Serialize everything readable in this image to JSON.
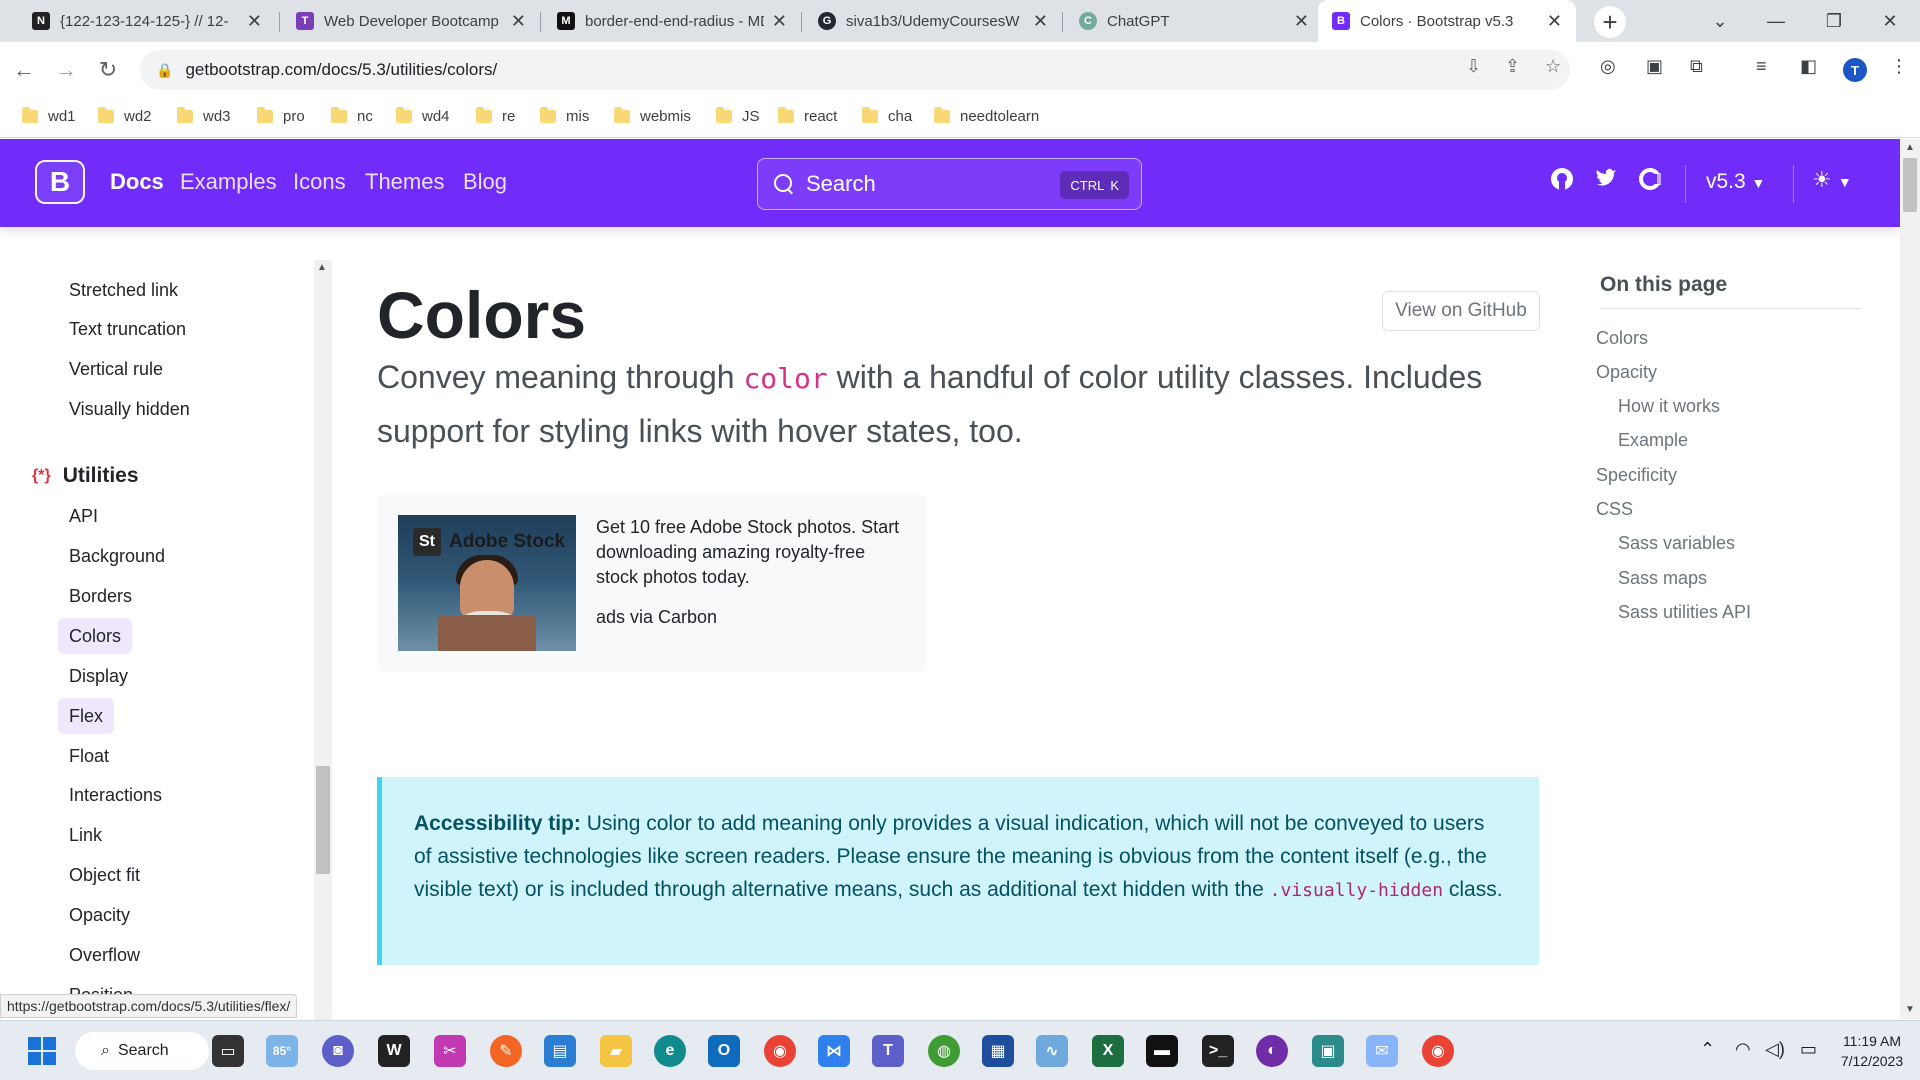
{
  "browser": {
    "tabs": [
      {
        "title": "{122-123-124-125-} // 12-",
        "favicon": "N",
        "color": "#222222"
      },
      {
        "title": "Web Developer Bootcamp",
        "favicon": "T",
        "color": "#7a3fb5"
      },
      {
        "title": "border-end-end-radius - MDN",
        "favicon": "M",
        "color": "#111111"
      },
      {
        "title": "siva1b3/UdemyCoursesW",
        "favicon": "G",
        "color": "#24292f"
      },
      {
        "title": "ChatGPT",
        "favicon": "C",
        "color": "#74aa9c"
      },
      {
        "title": "Colors · Bootstrap v5.3",
        "favicon": "B",
        "color": "#712cf9"
      }
    ],
    "url": "getbootstrap.com/docs/5.3/utilities/colors/",
    "profile_initial": "T",
    "bookmarks": [
      "wd1",
      "wd2",
      "wd3",
      "pro",
      "nc",
      "wd4",
      "re",
      "mis",
      "webmis",
      "JS",
      "react",
      "cha",
      "needtolearn"
    ]
  },
  "navbar": {
    "logo": "B",
    "links": [
      "Docs",
      "Examples",
      "Icons",
      "Themes",
      "Blog"
    ],
    "search_placeholder": "Search",
    "search_kbd_1": "CTRL",
    "search_kbd_2": "K",
    "version": "v5.3",
    "accent": "#712cf9"
  },
  "sidebar": {
    "items_top": [
      "Stretched link",
      "Text truncation",
      "Vertical rule",
      "Visually hidden"
    ],
    "section_title": "Utilities",
    "section_icon": "{*}",
    "items": [
      "API",
      "Background",
      "Borders",
      "Colors",
      "Display",
      "Flex",
      "Float",
      "Interactions",
      "Link",
      "Object fit",
      "Opacity",
      "Overflow",
      "Position"
    ]
  },
  "main": {
    "title": "Colors",
    "github_button": "View on GitHub",
    "lead_before": "Convey meaning through ",
    "lead_code": "color",
    "lead_after": " with a handful of color utility classes. Includes support for styling links with hover states, too.",
    "ad": {
      "brand_logo": "St",
      "brand_name": "Adobe Stock",
      "text": "Get 10 free Adobe Stock photos. Start downloading amazing royalty-free stock photos today.",
      "via": "ads via Carbon"
    },
    "callout": {
      "label": "Accessibility tip:",
      "text_1": " Using color to add meaning only provides a visual indication, which will not be conveyed to users of assistive technologies like screen readers. Please ensure the meaning is obvious from the content itself (e.g., the visible text) or is included through alternative means, such as additional text hidden with the ",
      "code": ".visually-hidden",
      "text_2": " class."
    }
  },
  "toc": {
    "title": "On this page",
    "items": [
      {
        "label": "Colors",
        "level": 1
      },
      {
        "label": "Opacity",
        "level": 1
      },
      {
        "label": "How it works",
        "level": 2
      },
      {
        "label": "Example",
        "level": 2
      },
      {
        "label": "Specificity",
        "level": 1
      },
      {
        "label": "CSS",
        "level": 1
      },
      {
        "label": "Sass variables",
        "level": 2
      },
      {
        "label": "Sass maps",
        "level": 2
      },
      {
        "label": "Sass utilities API",
        "level": 2
      }
    ]
  },
  "status_url": "https://getbootstrap.com/docs/5.3/utilities/flex/",
  "taskbar": {
    "search_label": "Search",
    "weather": "85°",
    "time": "11:19 AM",
    "date": "7/12/2023"
  }
}
